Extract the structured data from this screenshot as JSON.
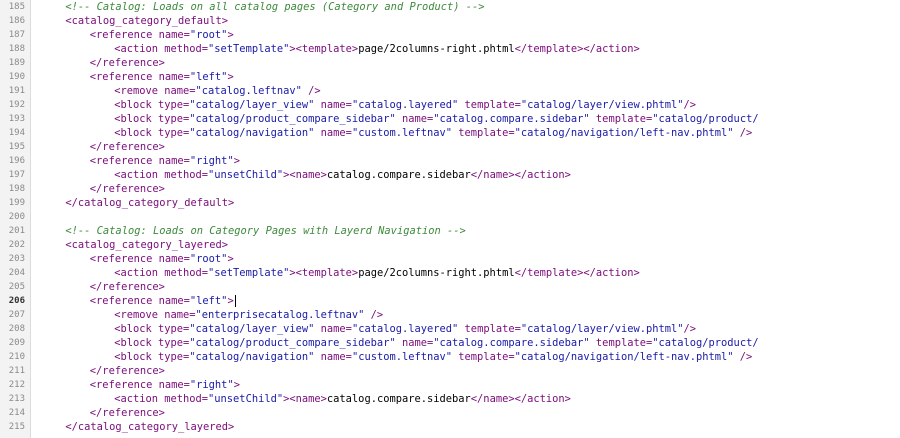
{
  "editor": {
    "active_line": "206",
    "lines": [
      {
        "n": "185",
        "ind": 4,
        "t": [
          [
            "cmt",
            "<!-- Catalog: Loads on all catalog pages (Category and Product) -->"
          ]
        ]
      },
      {
        "n": "186",
        "ind": 4,
        "t": [
          [
            "tag",
            "<catalog_category_default>"
          ]
        ]
      },
      {
        "n": "187",
        "ind": 8,
        "t": [
          [
            "tag",
            "<reference "
          ],
          [
            "attr",
            "name="
          ],
          [
            "str",
            "\"root\""
          ],
          [
            "tag",
            ">"
          ]
        ]
      },
      {
        "n": "188",
        "ind": 12,
        "t": [
          [
            "tag",
            "<action "
          ],
          [
            "attr",
            "method="
          ],
          [
            "str",
            "\"setTemplate\""
          ],
          [
            "tag",
            "><template>"
          ],
          [
            "txt",
            "page/2columns-right.phtml"
          ],
          [
            "tag",
            "</template></action>"
          ]
        ]
      },
      {
        "n": "189",
        "ind": 8,
        "t": [
          [
            "tag",
            "</reference>"
          ]
        ]
      },
      {
        "n": "190",
        "ind": 8,
        "t": [
          [
            "tag",
            "<reference "
          ],
          [
            "attr",
            "name="
          ],
          [
            "str",
            "\"left\""
          ],
          [
            "tag",
            ">"
          ]
        ]
      },
      {
        "n": "191",
        "ind": 12,
        "t": [
          [
            "tag",
            "<remove "
          ],
          [
            "attr",
            "name="
          ],
          [
            "str",
            "\"catalog.leftnav\""
          ],
          [
            "tag",
            " />"
          ]
        ]
      },
      {
        "n": "192",
        "ind": 12,
        "t": [
          [
            "tag",
            "<block "
          ],
          [
            "attr",
            "type="
          ],
          [
            "str",
            "\"catalog/layer_view\""
          ],
          [
            "attr",
            " name="
          ],
          [
            "str",
            "\"catalog.layered\""
          ],
          [
            "attr",
            " template="
          ],
          [
            "str",
            "\"catalog/layer/view.phtml\""
          ],
          [
            "tag",
            "/>"
          ]
        ]
      },
      {
        "n": "193",
        "ind": 12,
        "t": [
          [
            "tag",
            "<block "
          ],
          [
            "attr",
            "type="
          ],
          [
            "str",
            "\"catalog/product_compare_sidebar\""
          ],
          [
            "attr",
            " name="
          ],
          [
            "str",
            "\"catalog.compare.sidebar\""
          ],
          [
            "attr",
            " template="
          ],
          [
            "str",
            "\"catalog/product/"
          ]
        ]
      },
      {
        "n": "194",
        "ind": 12,
        "t": [
          [
            "tag",
            "<block "
          ],
          [
            "attr",
            "type="
          ],
          [
            "str",
            "\"catalog/navigation\""
          ],
          [
            "attr",
            " name="
          ],
          [
            "str",
            "\"custom.leftnav\""
          ],
          [
            "attr",
            " template="
          ],
          [
            "str",
            "\"catalog/navigation/left-nav.phtml\""
          ],
          [
            "tag",
            " />"
          ]
        ]
      },
      {
        "n": "195",
        "ind": 8,
        "t": [
          [
            "tag",
            "</reference>"
          ]
        ]
      },
      {
        "n": "196",
        "ind": 8,
        "t": [
          [
            "tag",
            "<reference "
          ],
          [
            "attr",
            "name="
          ],
          [
            "str",
            "\"right\""
          ],
          [
            "tag",
            ">"
          ]
        ]
      },
      {
        "n": "197",
        "ind": 12,
        "t": [
          [
            "tag",
            "<action "
          ],
          [
            "attr",
            "method="
          ],
          [
            "str",
            "\"unsetChild\""
          ],
          [
            "tag",
            "><name>"
          ],
          [
            "txt",
            "catalog.compare.sidebar"
          ],
          [
            "tag",
            "</name></action>"
          ]
        ]
      },
      {
        "n": "198",
        "ind": 8,
        "t": [
          [
            "tag",
            "</reference>"
          ]
        ]
      },
      {
        "n": "199",
        "ind": 4,
        "t": [
          [
            "tag",
            "</catalog_category_default>"
          ]
        ]
      },
      {
        "n": "200",
        "ind": 0,
        "t": []
      },
      {
        "n": "201",
        "ind": 4,
        "t": [
          [
            "cmt",
            "<!-- Catalog: Loads on Category Pages with Layerd Navigation -->"
          ]
        ]
      },
      {
        "n": "202",
        "ind": 4,
        "t": [
          [
            "tag",
            "<catalog_category_layered>"
          ]
        ]
      },
      {
        "n": "203",
        "ind": 8,
        "t": [
          [
            "tag",
            "<reference "
          ],
          [
            "attr",
            "name="
          ],
          [
            "str",
            "\"root\""
          ],
          [
            "tag",
            ">"
          ]
        ]
      },
      {
        "n": "204",
        "ind": 12,
        "t": [
          [
            "tag",
            "<action "
          ],
          [
            "attr",
            "method="
          ],
          [
            "str",
            "\"setTemplate\""
          ],
          [
            "tag",
            "><template>"
          ],
          [
            "txt",
            "page/2columns-right.phtml"
          ],
          [
            "tag",
            "</template></action>"
          ]
        ]
      },
      {
        "n": "205",
        "ind": 8,
        "t": [
          [
            "tag",
            "</reference>"
          ]
        ]
      },
      {
        "n": "206",
        "ind": 8,
        "t": [
          [
            "tag",
            "<reference "
          ],
          [
            "attr",
            "name="
          ],
          [
            "str",
            "\"left\""
          ],
          [
            "tag",
            ">"
          ]
        ],
        "caret": true
      },
      {
        "n": "207",
        "ind": 12,
        "t": [
          [
            "tag",
            "<remove "
          ],
          [
            "attr",
            "name="
          ],
          [
            "str",
            "\"enterprisecatalog.leftnav\""
          ],
          [
            "tag",
            " />"
          ]
        ]
      },
      {
        "n": "208",
        "ind": 12,
        "t": [
          [
            "tag",
            "<block "
          ],
          [
            "attr",
            "type="
          ],
          [
            "str",
            "\"catalog/layer_view\""
          ],
          [
            "attr",
            " name="
          ],
          [
            "str",
            "\"catalog.layered\""
          ],
          [
            "attr",
            " template="
          ],
          [
            "str",
            "\"catalog/layer/view.phtml\""
          ],
          [
            "tag",
            "/>"
          ]
        ]
      },
      {
        "n": "209",
        "ind": 12,
        "t": [
          [
            "tag",
            "<block "
          ],
          [
            "attr",
            "type="
          ],
          [
            "str",
            "\"catalog/product_compare_sidebar\""
          ],
          [
            "attr",
            " name="
          ],
          [
            "str",
            "\"catalog.compare.sidebar\""
          ],
          [
            "attr",
            " template="
          ],
          [
            "str",
            "\"catalog/product/"
          ]
        ]
      },
      {
        "n": "210",
        "ind": 12,
        "t": [
          [
            "tag",
            "<block "
          ],
          [
            "attr",
            "type="
          ],
          [
            "str",
            "\"catalog/navigation\""
          ],
          [
            "attr",
            " name="
          ],
          [
            "str",
            "\"custom.leftnav\""
          ],
          [
            "attr",
            " template="
          ],
          [
            "str",
            "\"catalog/navigation/left-nav.phtml\""
          ],
          [
            "tag",
            " />"
          ]
        ]
      },
      {
        "n": "211",
        "ind": 8,
        "t": [
          [
            "tag",
            "</reference>"
          ]
        ]
      },
      {
        "n": "212",
        "ind": 8,
        "t": [
          [
            "tag",
            "<reference "
          ],
          [
            "attr",
            "name="
          ],
          [
            "str",
            "\"right\""
          ],
          [
            "tag",
            ">"
          ]
        ]
      },
      {
        "n": "213",
        "ind": 12,
        "t": [
          [
            "tag",
            "<action "
          ],
          [
            "attr",
            "method="
          ],
          [
            "str",
            "\"unsetChild\""
          ],
          [
            "tag",
            "><name>"
          ],
          [
            "txt",
            "catalog.compare.sidebar"
          ],
          [
            "tag",
            "</name></action>"
          ]
        ]
      },
      {
        "n": "214",
        "ind": 8,
        "t": [
          [
            "tag",
            "</reference>"
          ]
        ]
      },
      {
        "n": "215",
        "ind": 4,
        "t": [
          [
            "tag",
            "</catalog_category_layered>"
          ]
        ]
      }
    ]
  }
}
